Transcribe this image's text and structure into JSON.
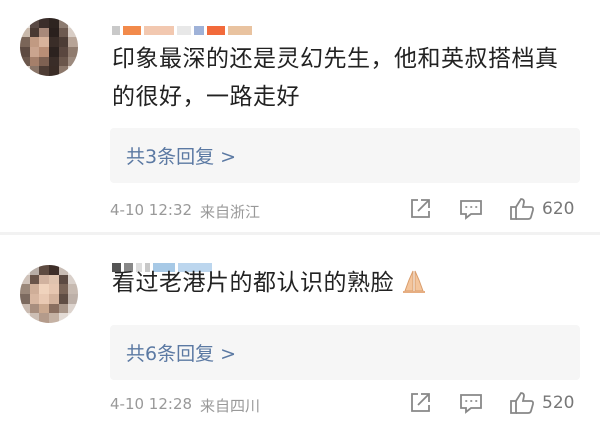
{
  "comments": [
    {
      "text": "印象最深的还是灵幻先生，他和英叔搭档真的很好，一路走好",
      "replies_label": "共3条回复 >",
      "date": "4-10 12:32",
      "location": "来自浙江",
      "likes": "620"
    },
    {
      "text": "看过老港片的都认识的熟脸",
      "emoji": "folded-hands-icon",
      "replies_label": "共6条回复 >",
      "date": "4-10 12:28",
      "location": "来自四川",
      "likes": "520"
    }
  ],
  "colors": {
    "reply_link": "#5b79a3",
    "meta_text": "#999999",
    "reply_bg": "#f6f6f6"
  }
}
